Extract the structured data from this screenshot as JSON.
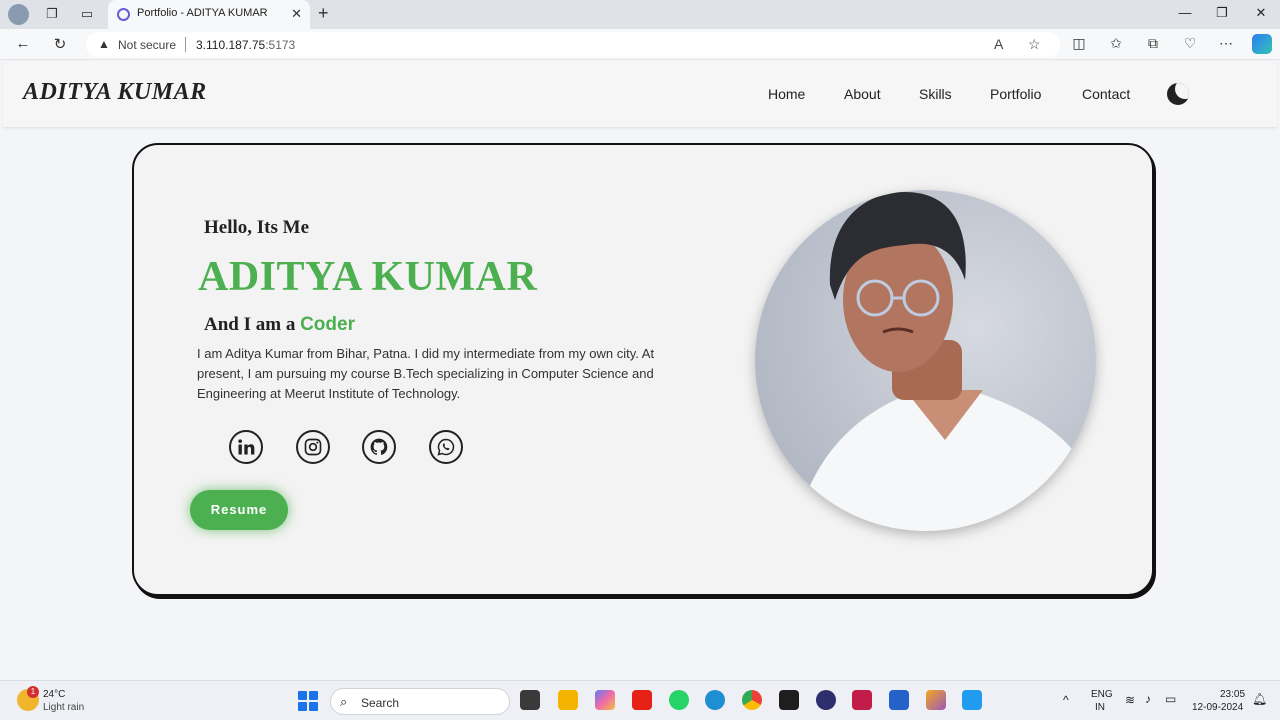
{
  "browser": {
    "tab_title": "Portfolio - ADITYA KUMAR",
    "security_label": "Not secure",
    "url_host": "3.110.187.75",
    "url_port": ":5173"
  },
  "site": {
    "logo": "ADITYA KUMAR",
    "nav": [
      "Home",
      "About",
      "Skills",
      "Portfolio",
      "Contact"
    ]
  },
  "hero": {
    "greeting": "Hello, Its Me",
    "name": "ADITYA KUMAR",
    "role_prefix": "And I am a",
    "role": "Coder",
    "bio": "I am Aditya Kumar from Bihar, Patna. I did my intermediate from my own city. At present, I am pursuing my course B.Tech specializing in Computer Science and Engineering at Meerut Institute of Technology.",
    "social_icons": [
      "linkedin-icon",
      "instagram-icon",
      "github-icon",
      "whatsapp-icon"
    ],
    "resume_label": "Resume",
    "accent_color": "#4caf50"
  },
  "taskbar": {
    "temperature": "24°C",
    "weather": "Light rain",
    "weather_badge": "1",
    "search_label": "Search",
    "lang": "ENG",
    "region": "IN",
    "time": "23:05",
    "date": "12-09-2024"
  }
}
